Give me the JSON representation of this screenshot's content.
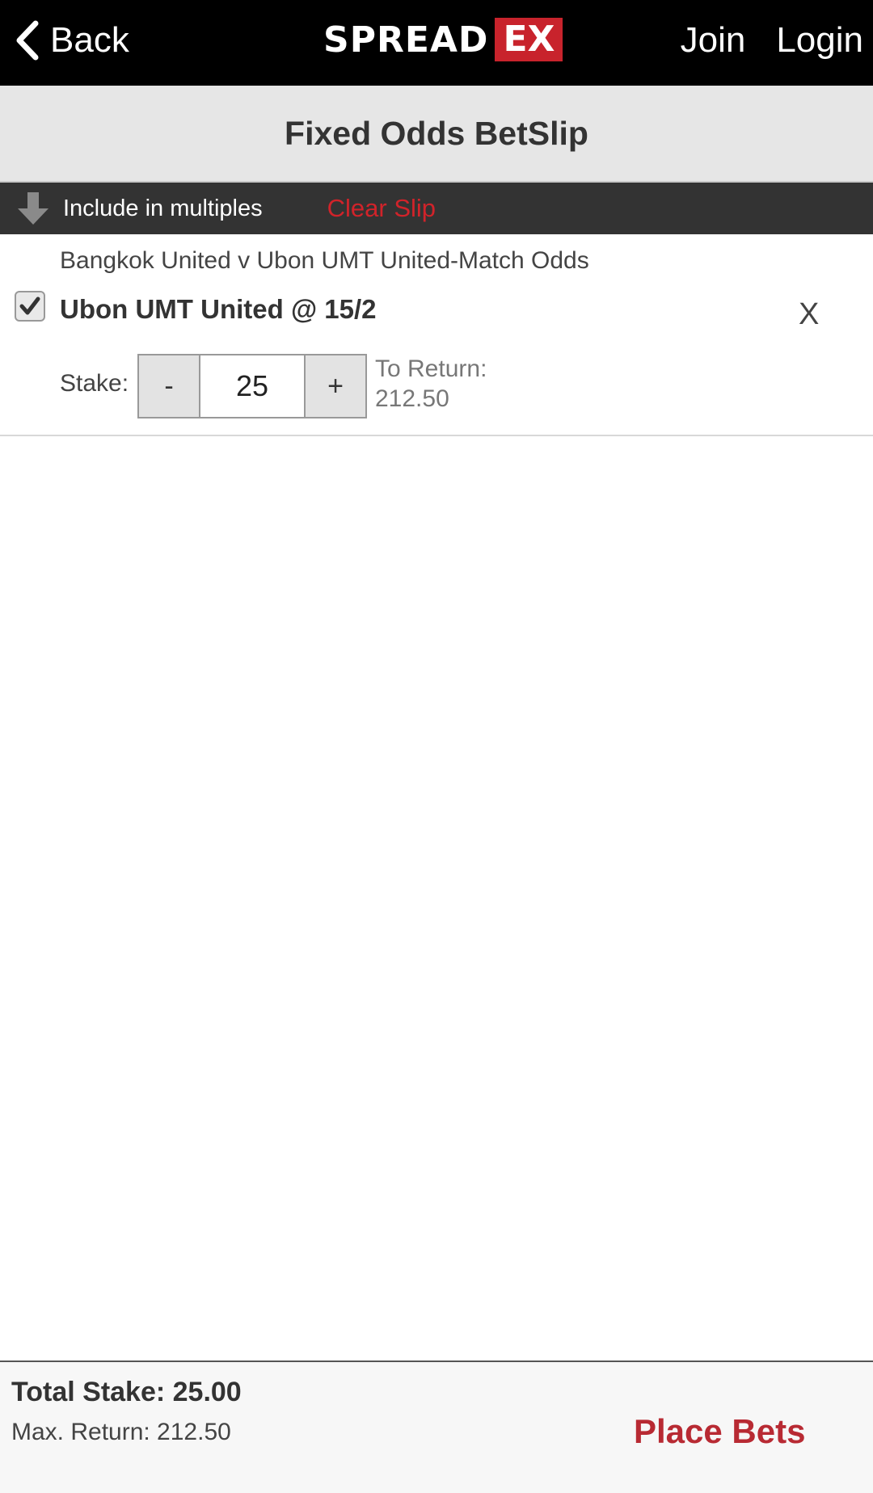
{
  "header": {
    "back_label": "Back",
    "logo_text_main": "SPREAD",
    "logo_text_badge": "EX",
    "join_label": "Join",
    "login_label": "Login",
    "brand_color": "#c8232c"
  },
  "page": {
    "title": "Fixed Odds BetSlip"
  },
  "toolbar": {
    "include_multiples_label": "Include in multiples",
    "clear_slip_label": "Clear Slip"
  },
  "bet": {
    "event": "Bangkok United v Ubon UMT United-Match Odds",
    "selection": "Ubon UMT United @ 15/2",
    "checked": true,
    "remove_label": "X",
    "stake_label": "Stake:",
    "minus_label": "-",
    "stake_value": "25",
    "plus_label": "+",
    "to_return_label": "To Return:",
    "to_return_value": "212.50"
  },
  "footer": {
    "total_stake": "Total Stake: 25.00",
    "max_return": "Max. Return: 212.50",
    "place_bets_label": "Place Bets"
  }
}
